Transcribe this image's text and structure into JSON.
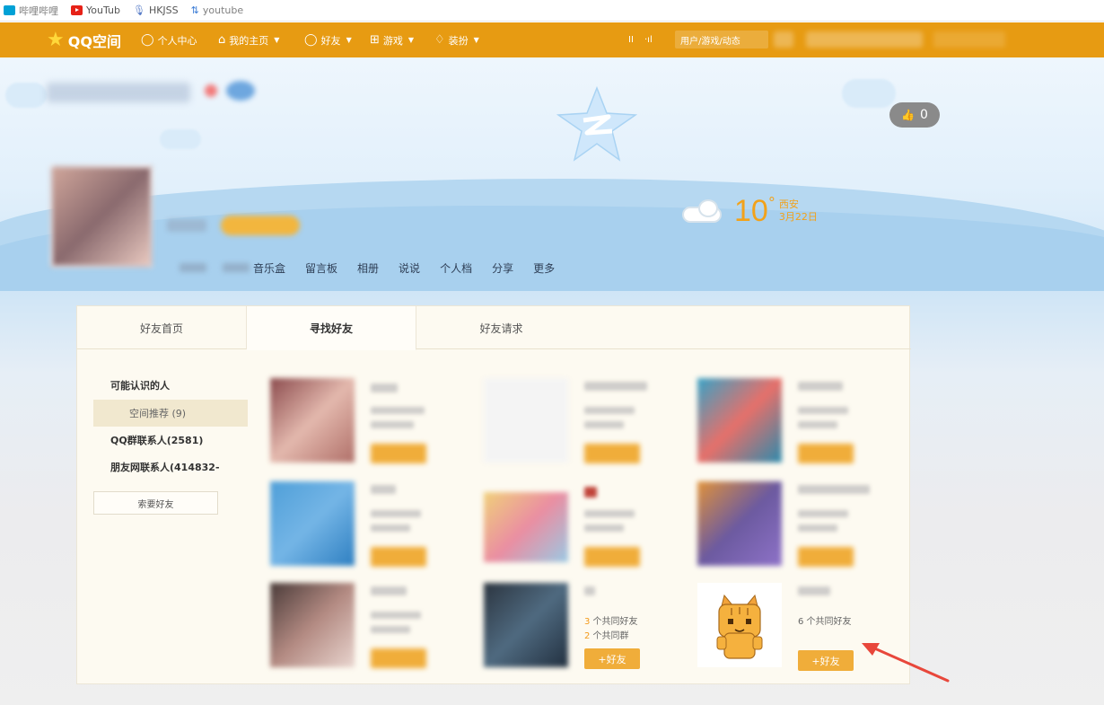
{
  "bookmarks": [
    {
      "label": "哔哩哔哩",
      "icon": "bilibili-icon"
    },
    {
      "label": "YouTub",
      "icon": "youtube-icon"
    },
    {
      "label": "HKJSS",
      "icon": "microphone-icon"
    },
    {
      "label": "youtube",
      "icon": "link-icon"
    }
  ],
  "qqnav": {
    "logo": "QQ空间",
    "items": [
      {
        "label": "个人中心",
        "icon": "person-icon"
      },
      {
        "label": "我的主页",
        "icon": "home-icon"
      },
      {
        "label": "好友",
        "icon": "friends-icon"
      },
      {
        "label": "游戏",
        "icon": "grid-icon"
      },
      {
        "label": "装扮",
        "icon": "shirt-icon"
      }
    ],
    "search_placeholder": "用户/游戏/动态",
    "pause_glyph": "II",
    "signal_glyph": "·ıl"
  },
  "hero": {
    "likes": "0",
    "weather": {
      "temperature": "10",
      "degree": "°",
      "city": "西安",
      "date": "3月22日"
    },
    "subnav": [
      "音乐盒",
      "留言板",
      "相册",
      "说说",
      "个人档",
      "分享",
      "更多"
    ]
  },
  "panel": {
    "tabs": [
      "好友首页",
      "寻找好友",
      "好友请求"
    ],
    "active_tab": "寻找好友",
    "side": {
      "title": "可能认识的人",
      "items": [
        {
          "label": "空间推荐 (9)",
          "selected": true
        },
        {
          "label": "QQ群联系人(2581)",
          "selected": false
        },
        {
          "label": "朋友网联系人(414832-",
          "selected": false
        }
      ],
      "request_button": "索要好友"
    },
    "cards": [
      {
        "visible": false
      },
      {
        "visible": false
      },
      {
        "visible": false
      },
      {
        "visible": false
      },
      {
        "visible": false
      },
      {
        "visible": false
      },
      {
        "visible": false
      },
      {
        "visible": true,
        "mutual_friends_num": "3",
        "mutual_friends_text": " 个共同好友",
        "mutual_groups_num": "2",
        "mutual_groups_text": " 个共同群",
        "add_button": "+好友"
      },
      {
        "visible": true,
        "mutual_friends_num": "6",
        "mutual_friends_text": " 个共同好友",
        "add_button": "+好友"
      }
    ]
  },
  "colors": {
    "nav_bg": "#e79b12",
    "accent": "#f0ad3a",
    "weather": "#f2a21a",
    "arrow": "#e8473b"
  }
}
